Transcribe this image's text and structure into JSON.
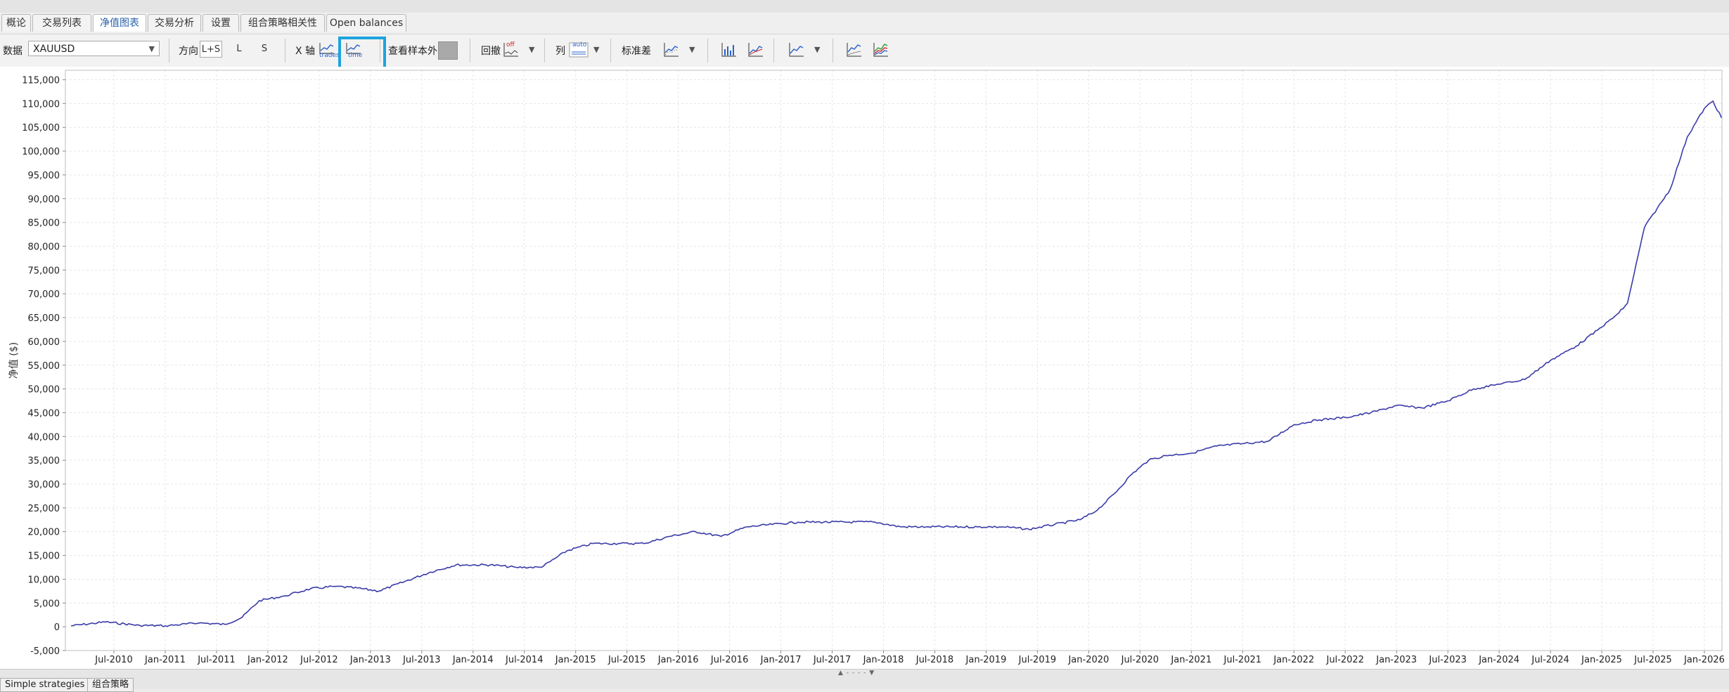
{
  "tabs": [
    "概论",
    "交易列表",
    "净值图表",
    "交易分析",
    "设置",
    "组合策略相关性",
    "Open balances"
  ],
  "active_tab": 2,
  "toolbar": {
    "data_label": "数据",
    "data_value": "XAUUSD",
    "direction_label": "方向",
    "direction_options": [
      "L+S",
      "L",
      "S"
    ],
    "direction_selected": "L+S",
    "xaxis_label": "X 轴",
    "xaxis_trades_label": "trades",
    "xaxis_time_label": "time",
    "oos_label": "查看样本外",
    "drawdown_label": "回撤",
    "drawdown_state": "off",
    "columns_label": "列",
    "columns_state": "auto",
    "std_label": "标准差"
  },
  "chart_data": {
    "type": "line",
    "ylabel": "净值 ($)",
    "ylim": [
      -5000,
      117000
    ],
    "yticks": [
      "115,000",
      "110,000",
      "105,000",
      "100,000",
      "95,000",
      "90,000",
      "85,000",
      "80,000",
      "75,000",
      "70,000",
      "65,000",
      "60,000",
      "55,000",
      "50,000",
      "45,000",
      "40,000",
      "35,000",
      "30,000",
      "25,000",
      "20,000",
      "15,000",
      "10,000",
      "5,000",
      "0",
      "-5,000"
    ],
    "xticks": [
      "Jul-2010",
      "Jan-2011",
      "Jul-2011",
      "Jan-2012",
      "Jul-2012",
      "Jan-2013",
      "Jul-2013",
      "Jan-2014",
      "Jul-2014",
      "Jan-2015",
      "Jul-2015",
      "Jan-2016",
      "Jul-2016",
      "Jan-2017",
      "Jul-2017",
      "Jan-2018",
      "Jul-2018",
      "Jan-2019",
      "Jul-2019",
      "Jan-2020",
      "Jul-2020",
      "Jan-2021",
      "Jul-2021",
      "Jan-2022",
      "Jul-2022",
      "Jan-2023",
      "Jul-2023",
      "Jan-2024",
      "Jul-2024",
      "Jan-2025",
      "Jul-2025",
      "Jan-2026"
    ],
    "grid": true,
    "line_color": "#3a3aa8",
    "series": [
      {
        "x": [
          "2010-02",
          "2010-06",
          "2010-10",
          "2011-01",
          "2011-05",
          "2011-08",
          "2011-10",
          "2011-12",
          "2012-03",
          "2012-06",
          "2012-09",
          "2012-12",
          "2013-02",
          "2013-05",
          "2013-08",
          "2013-11",
          "2014-03",
          "2014-06",
          "2014-09",
          "2014-12",
          "2015-03",
          "2015-06",
          "2015-09",
          "2015-12",
          "2016-03",
          "2016-06",
          "2016-09",
          "2016-12",
          "2017-03",
          "2017-06",
          "2017-09",
          "2017-12",
          "2018-03",
          "2018-06",
          "2018-09",
          "2018-12",
          "2019-03",
          "2019-06",
          "2019-09",
          "2019-12",
          "2020-02",
          "2020-04",
          "2020-06",
          "2020-08",
          "2020-10",
          "2021-01",
          "2021-04",
          "2021-07",
          "2021-10",
          "2022-01",
          "2022-04",
          "2022-07",
          "2022-10",
          "2023-01",
          "2023-04",
          "2023-07",
          "2023-10",
          "2024-01",
          "2024-04",
          "2024-07",
          "2024-10",
          "2025-01",
          "2025-03",
          "2025-04",
          "2025-06",
          "2025-09",
          "2025-11",
          "2026-01",
          "2026-02",
          "2026-03"
        ],
        "values": [
          200,
          1000,
          300,
          200,
          800,
          500,
          2000,
          5500,
          6500,
          8000,
          8500,
          8000,
          7500,
          9500,
          11500,
          13000,
          13000,
          12500,
          12500,
          16000,
          17500,
          17500,
          17500,
          19000,
          20000,
          19000,
          21000,
          21500,
          22000,
          22000,
          22000,
          22000,
          21000,
          21000,
          21000,
          21000,
          21000,
          20500,
          21500,
          22500,
          24500,
          28000,
          32000,
          35000,
          36000,
          36500,
          38000,
          38500,
          39000,
          42500,
          43500,
          44000,
          45000,
          46500,
          46000,
          47500,
          50000,
          51000,
          52000,
          56000,
          59000,
          63000,
          66000,
          68000,
          84000,
          92000,
          103000,
          109000,
          110500,
          107000
        ]
      }
    ]
  },
  "bottom_tabs": [
    "Simple strategies",
    "组合策略"
  ]
}
